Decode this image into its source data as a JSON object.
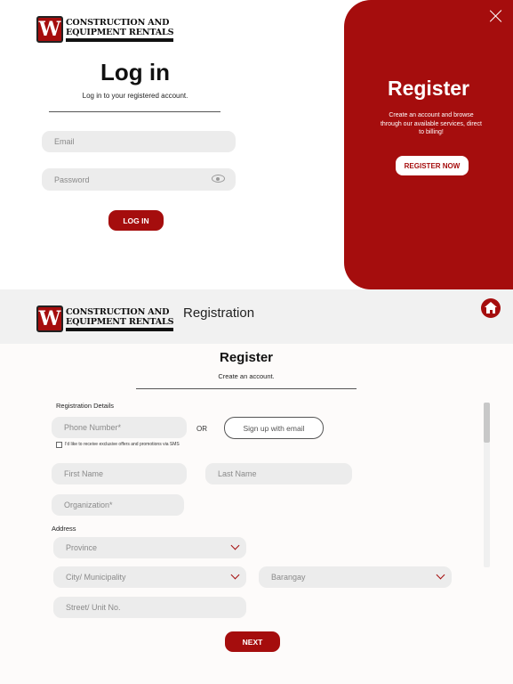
{
  "brand": {
    "logo_letter": "W",
    "line1": "CONSTRUCTION AND",
    "line2": "EQUIPMENT RENTALS"
  },
  "colors": {
    "accent": "#a50d0d",
    "field_bg": "#ececec",
    "header_bg": "#f1f1f1"
  },
  "login": {
    "title": "Log in",
    "subtitle": "Log in to your registered account.",
    "email_placeholder": "Email",
    "password_placeholder": "Password",
    "submit_label": "LOG IN"
  },
  "register_panel": {
    "title": "Register",
    "description": "Create an account and browse through our available services, direct to billing!",
    "button_label": "REGISTER NOW",
    "close_icon": "close-icon"
  },
  "registration": {
    "header_title": "Registration",
    "home_icon": "home-icon",
    "title": "Register",
    "subtitle": "Create an account.",
    "details_label": "Registration Details",
    "phone_placeholder": "Phone Number*",
    "or_label": "OR",
    "email_signup_label": "Sign up with email",
    "sms_optin_label": "I'd like to receive exclusive offers and promotions via SMS",
    "first_name_placeholder": "First Name",
    "last_name_placeholder": "Last Name",
    "organization_placeholder": "Organization*",
    "address_label": "Address",
    "province_placeholder": "Province",
    "city_placeholder": "City/ Municipality",
    "barangay_placeholder": "Barangay",
    "street_placeholder": "Street/ Unit No.",
    "next_label": "NEXT"
  }
}
